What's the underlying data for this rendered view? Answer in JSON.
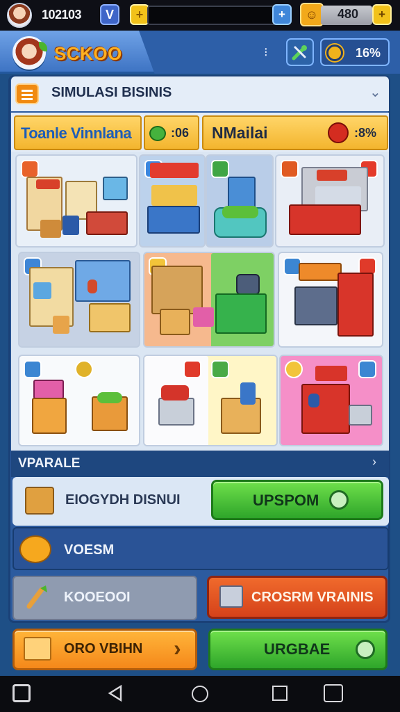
{
  "statusbar": {
    "player_id": "102103",
    "vip_icon": "V",
    "gem_icon": "+",
    "energy_plus": "+",
    "coin_value": "480",
    "coin_plus": "+"
  },
  "header": {
    "game_title": "SCKOO",
    "dots": "⁝",
    "tools_icon": "wrench-icon",
    "timer_value": "16%"
  },
  "section": {
    "title": "SIMULASI BISINIS",
    "chevron": "⌄"
  },
  "info": {
    "name": "Toanle Vinnlana",
    "count": ":06",
    "market": "NMailai",
    "market_value": ":8%"
  },
  "shops": [
    {
      "id": "office-shop"
    },
    {
      "id": "market-stall"
    },
    {
      "id": "produce-basket"
    },
    {
      "id": "convenience-store"
    },
    {
      "id": "office-desk"
    },
    {
      "id": "cashier-counter"
    },
    {
      "id": "storage-cart"
    },
    {
      "id": "vending-machine"
    },
    {
      "id": "shopping-cart"
    },
    {
      "id": "produce-crate"
    },
    {
      "id": "checkout-stall"
    }
  ],
  "subsection": {
    "title": "VPARALE",
    "chevron": "›"
  },
  "actions": {
    "row1_label": "EIOGYDH DISNUI",
    "upgrade_label": "UPSPOM",
    "row2_label": "VOESM",
    "row3_left_label": "KOOEOOI",
    "row3_right_label": "CROSRM VRAINIS",
    "orange_label": "ORO VBIHN",
    "orange_arrow": "›",
    "buy_label": "URGBAE"
  },
  "colors": {
    "accent_green": "#2ea52a",
    "accent_orange": "#f5881a",
    "accent_red": "#d5421a",
    "panel_blue": "#2c5b9f"
  }
}
